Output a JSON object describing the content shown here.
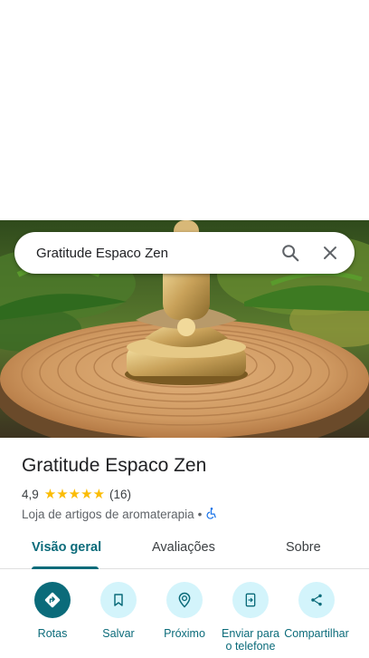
{
  "search": {
    "query": "Gratitude Espaco Zen",
    "search_icon": "search-icon",
    "close_icon": "close-icon"
  },
  "place": {
    "name": "Gratitude Espaco Zen",
    "rating": "4,9",
    "stars": "★★★★★",
    "star_value": 4.9,
    "review_count": "(16)",
    "category": "Loja de artigos de aromaterapia",
    "separator": "•",
    "accessibility_icon": "wheelchair-icon"
  },
  "tabs": [
    {
      "label": "Visão geral",
      "active": true
    },
    {
      "label": "Avaliações",
      "active": false
    },
    {
      "label": "Sobre",
      "active": false
    }
  ],
  "actions": [
    {
      "label": "Rotas",
      "icon": "directions-icon"
    },
    {
      "label": "Salvar",
      "icon": "bookmark-icon"
    },
    {
      "label": "Próximo",
      "icon": "nearby-icon"
    },
    {
      "label": "Enviar para o telefone",
      "icon": "send-to-phone-icon"
    },
    {
      "label": "Compartilhar",
      "icon": "share-icon"
    }
  ],
  "colors": {
    "accent": "#0b6b7a",
    "chip_bg": "#d3f4fb",
    "star": "#fbbc04"
  }
}
